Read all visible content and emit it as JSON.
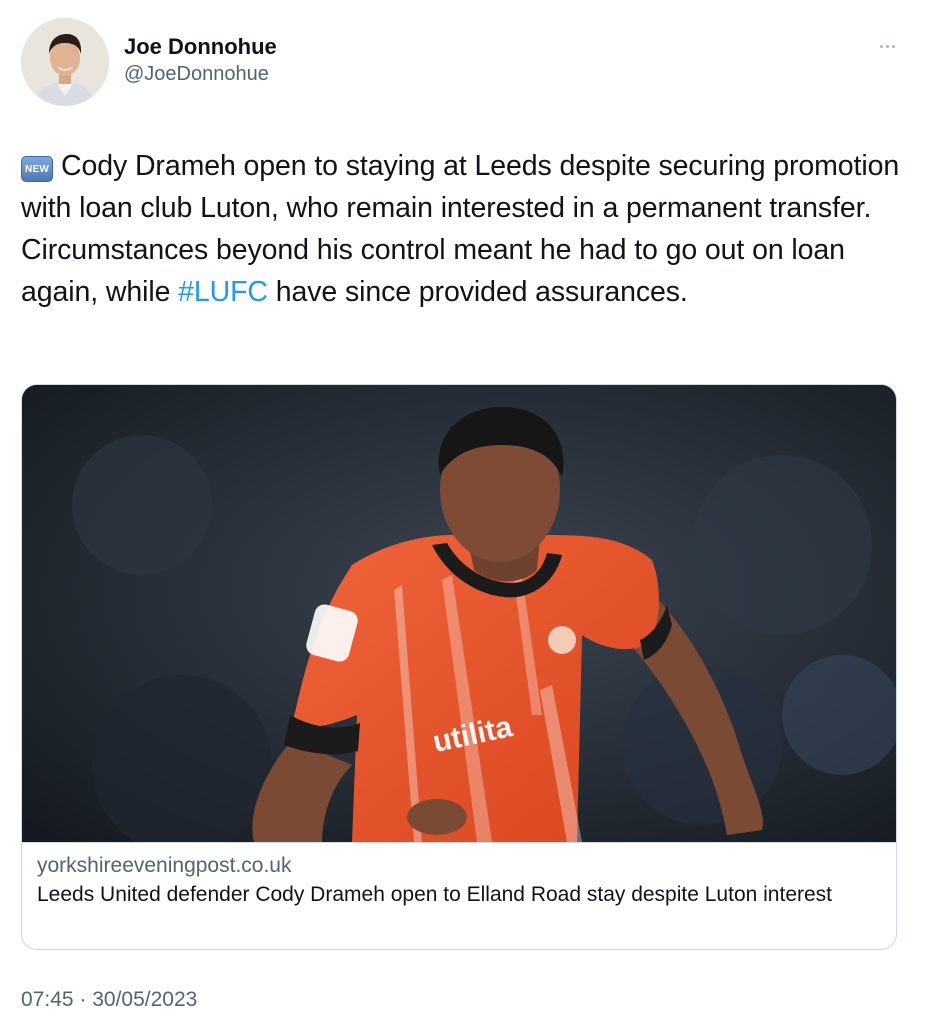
{
  "author": {
    "display_name": "Joe Donnohue",
    "handle": "@JoeDonnohue",
    "avatar_icon": "profile-photo"
  },
  "header": {
    "more_icon": "more-horizontal-icon"
  },
  "tweet": {
    "badge_emoji": "NEW",
    "text_before_hashtag": "Cody Drameh open to staying at Leeds despite securing promotion with loan club Luton, who remain interested in a permanent transfer. Circumstances beyond his control meant he had to go out on loan again, while ",
    "hashtag": "#LUFC",
    "text_after_hashtag": " have since provided assurances."
  },
  "link_card": {
    "image_icon": "footballer-photo",
    "domain": "yorkshireeveningpost.co.uk",
    "title": "Leeds United defender Cody Drameh open to Elland Road stay despite Luton interest"
  },
  "meta": {
    "timestamp": "07:45 · 30/05/2023"
  },
  "colors": {
    "text_primary": "#0f1419",
    "text_secondary": "#536471",
    "link": "#1d9bf0",
    "border": "#cfd9de",
    "kit_orange": "#e8522c"
  }
}
